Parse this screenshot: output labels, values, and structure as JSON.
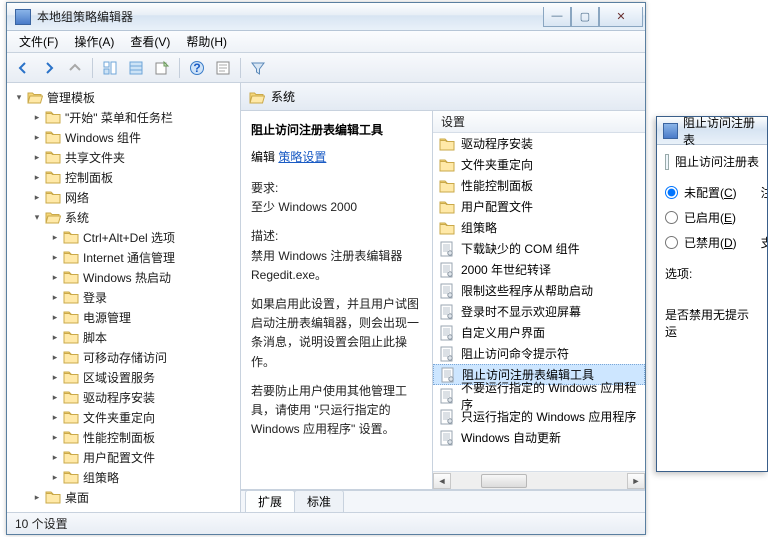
{
  "window": {
    "title": "本地组策略编辑器",
    "min": "—",
    "max": "▢",
    "close": "✕"
  },
  "menu": [
    "文件(F)",
    "操作(A)",
    "查看(V)",
    "帮助(H)"
  ],
  "toolbar_icons": [
    "back",
    "forward",
    "up",
    "show-hide-tree",
    "show-hide-list",
    "export",
    "help",
    "properties",
    "filter"
  ],
  "tree": {
    "root": {
      "label": "管理模板",
      "expanded": true
    },
    "children": [
      {
        "label": "\"开始\" 菜单和任务栏"
      },
      {
        "label": "Windows 组件"
      },
      {
        "label": "共享文件夹"
      },
      {
        "label": "控制面板"
      },
      {
        "label": "网络"
      },
      {
        "label": "系统",
        "expanded": true,
        "children": [
          {
            "label": "Ctrl+Alt+Del 选项"
          },
          {
            "label": "Internet 通信管理"
          },
          {
            "label": "Windows 热启动"
          },
          {
            "label": "登录"
          },
          {
            "label": "电源管理"
          },
          {
            "label": "脚本"
          },
          {
            "label": "可移动存储访问"
          },
          {
            "label": "区域设置服务"
          },
          {
            "label": "驱动程序安装"
          },
          {
            "label": "文件夹重定向"
          },
          {
            "label": "性能控制面板"
          },
          {
            "label": "用户配置文件"
          },
          {
            "label": "组策略"
          }
        ]
      },
      {
        "label": "桌面"
      }
    ]
  },
  "content": {
    "heading": "系统",
    "setting_column": "设置",
    "desc": {
      "title": "阻止访问注册表编辑工具",
      "edit_label": "编辑",
      "edit_link": "策略设置",
      "req_label": "要求:",
      "req_val": "至少 Windows 2000",
      "desc_label": "描述:",
      "p1": "禁用 Windows 注册表编辑器 Regedit.exe。",
      "p2": "如果启用此设置，并且用户试图启动注册表编辑器，则会出现一条消息，说明设置会阻止此操作。",
      "p3": "若要防止用户使用其他管理工具，请使用 \"只运行指定的 Windows 应用程序\" 设置。"
    },
    "items": [
      {
        "type": "folder",
        "label": "驱动程序安装"
      },
      {
        "type": "folder",
        "label": "文件夹重定向"
      },
      {
        "type": "folder",
        "label": "性能控制面板"
      },
      {
        "type": "folder",
        "label": "用户配置文件"
      },
      {
        "type": "folder",
        "label": "组策略"
      },
      {
        "type": "policy",
        "label": "下载缺少的 COM 组件"
      },
      {
        "type": "policy",
        "label": "2000 年世纪转译"
      },
      {
        "type": "policy",
        "label": "限制这些程序从帮助启动"
      },
      {
        "type": "policy",
        "label": "登录时不显示欢迎屏幕"
      },
      {
        "type": "policy",
        "label": "自定义用户界面"
      },
      {
        "type": "policy",
        "label": "阻止访问命令提示符"
      },
      {
        "type": "policy",
        "label": "阻止访问注册表编辑工具",
        "selected": true
      },
      {
        "type": "policy",
        "label": "不要运行指定的 Windows 应用程序"
      },
      {
        "type": "policy",
        "label": "只运行指定的 Windows 应用程序"
      },
      {
        "type": "policy",
        "label": "Windows 自动更新"
      }
    ],
    "tabs": {
      "extended": "扩展",
      "standard": "标准"
    }
  },
  "status": "10 个设置",
  "dialog": {
    "title": "阻止访问注册表",
    "line1": "阻止访问注册表",
    "radio_unconf": "未配置(C)",
    "radio_enabled": "已启用(E)",
    "radio_disabled": "已禁用(D)",
    "note": "注",
    "support": "支",
    "options": "选项:",
    "body": "是否禁用无提示运"
  }
}
